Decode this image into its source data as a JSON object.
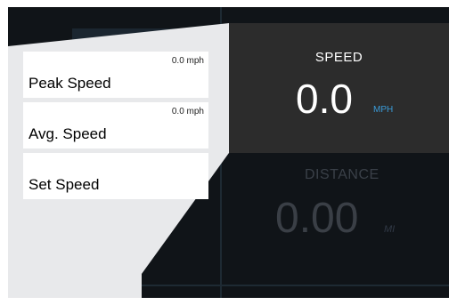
{
  "speed": {
    "title": "SPEED",
    "value": "0.0",
    "unit": "MPH"
  },
  "distance": {
    "title": "DISTANCE",
    "value": "0.00",
    "unit": "MI"
  },
  "stats": [
    {
      "label": "Peak Speed",
      "value": "0.0 mph"
    },
    {
      "label": "Avg. Speed",
      "value": "0.0 mph"
    },
    {
      "label": "Set Speed",
      "value": ""
    }
  ],
  "colors": {
    "screen_bg": "#101418",
    "panel_bg": "#e8e9eb",
    "card_bg": "#2c2c2c",
    "accent": "#3a9bd8"
  }
}
